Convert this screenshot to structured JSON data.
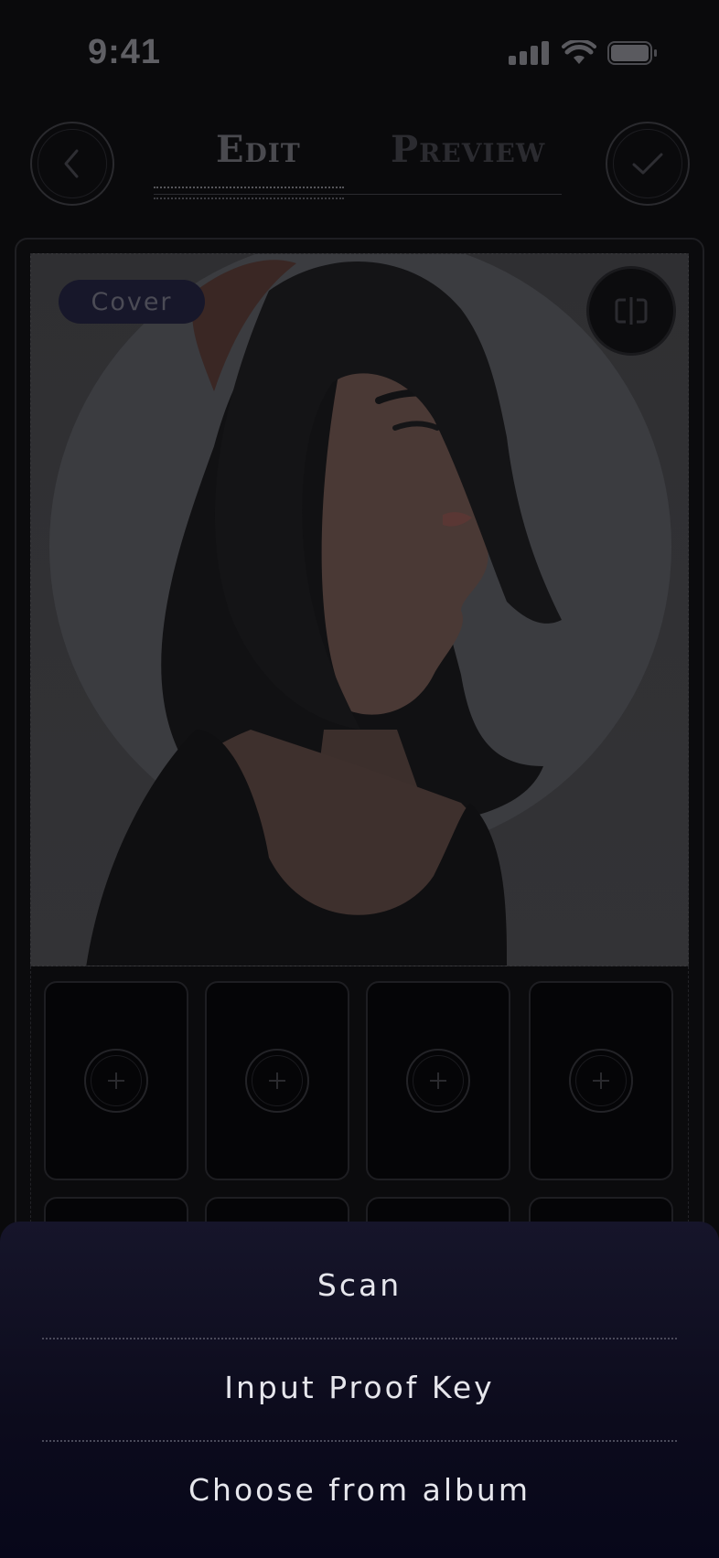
{
  "status_bar": {
    "time": "9:41",
    "icons": [
      "signal-icon",
      "wifi-icon",
      "battery-icon"
    ]
  },
  "nav": {
    "back_icon": "chevron-left-icon",
    "done_icon": "checkmark-icon",
    "tabs": [
      {
        "label": "Edit",
        "active": true
      },
      {
        "label": "Preview",
        "active": false
      }
    ]
  },
  "editor": {
    "cover_label": "Cover",
    "swap_icon": "swap-icon",
    "add_icon": "plus-icon",
    "slots_visible_full": 4
  },
  "action_sheet": {
    "items": [
      {
        "label": "Scan"
      },
      {
        "label": "Input Proof Key"
      },
      {
        "label": "Choose from album"
      }
    ]
  },
  "colors": {
    "background": "#0a0a0c",
    "sheet_top": "#16152a",
    "sheet_bottom": "#07071a",
    "sheet_text": "#e6e6ec"
  }
}
